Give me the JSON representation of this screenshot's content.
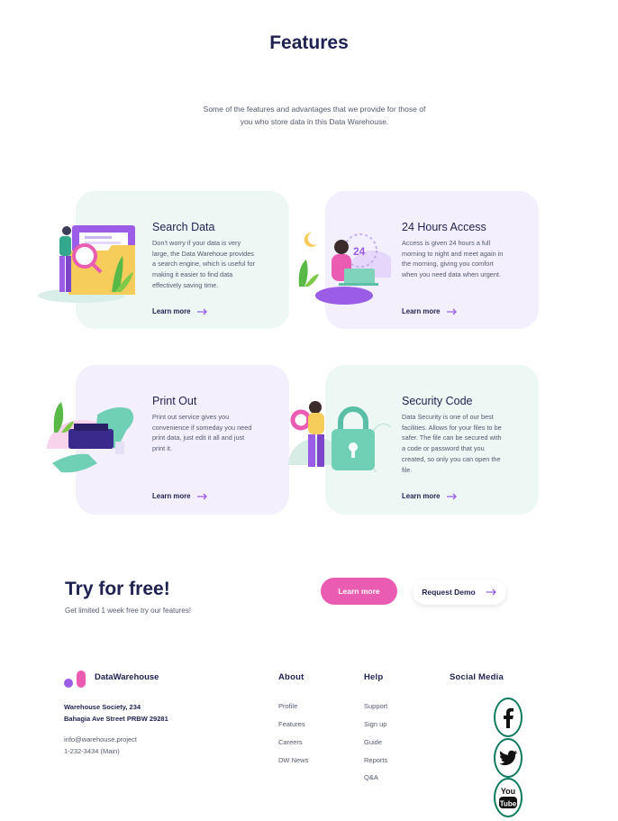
{
  "header": {
    "title": "Features",
    "intro_line1": "Some of the features and advantages that we provide for those of",
    "intro_line2": "you who store data in this Data Warehouse."
  },
  "cards": [
    {
      "title": "Search Data",
      "text": [
        "Don’t worry if your data is very",
        "large, the Data Warehoue provides",
        "a search engine, which is useful for",
        "making it easier to find data",
        "effectively saving time."
      ],
      "link": "Learn more"
    },
    {
      "title": "24 Hours Access",
      "text": [
        "Access is given 24 hours a full",
        "morning to night and meet again in",
        "the morning, giving you comfort",
        "when you need data when urgent."
      ],
      "link": "Learn more"
    },
    {
      "title": "Print Out",
      "text": [
        "Print out service gives you",
        "convenience if someday you need",
        "print data, just edit it all and just",
        "print it."
      ],
      "link": "Learn more"
    },
    {
      "title": "Security Code",
      "text": [
        "Data Security is one of our best",
        "facilities. Allows for your files to be",
        "safer. The file can be secured with",
        "a code or password that you",
        "created, so only you can open the",
        "file."
      ],
      "link": "Learn more"
    }
  ],
  "illustration_labels": {
    "clock_number": "24"
  },
  "cta": {
    "title": "Try for free!",
    "subtitle": "Get limited 1 week free try our features!",
    "learn_more": "Learn more",
    "request_demo": "Request Demo"
  },
  "footer": {
    "brand": "DataWarehouse",
    "address_line1": "Warehouse Society, 234",
    "address_line2": "Bahagia Ave Street PRBW 29281",
    "email": "info@warehouse.project",
    "phone": "1-232-3434 (Main)",
    "about": {
      "heading": "About",
      "links": [
        "Profile",
        "Features",
        "Careers",
        "DW News"
      ]
    },
    "help": {
      "heading": "Help",
      "links": [
        "Support",
        "Sign up",
        "Guide",
        "Reports",
        "Q&A"
      ]
    },
    "social": {
      "heading": "Social Media",
      "icons": [
        "facebook-icon",
        "twitter-icon",
        "youtube-icon"
      ],
      "youtube_label_top": "You",
      "youtube_label_bottom": "Tube"
    }
  },
  "colors": {
    "navy": "#1f2150",
    "pink": "#ea5bb2",
    "mint_card": "#edf7f4",
    "lavender_card": "#f4effd",
    "social_green": "#0d7a5f",
    "purple": "#9b5de5"
  }
}
